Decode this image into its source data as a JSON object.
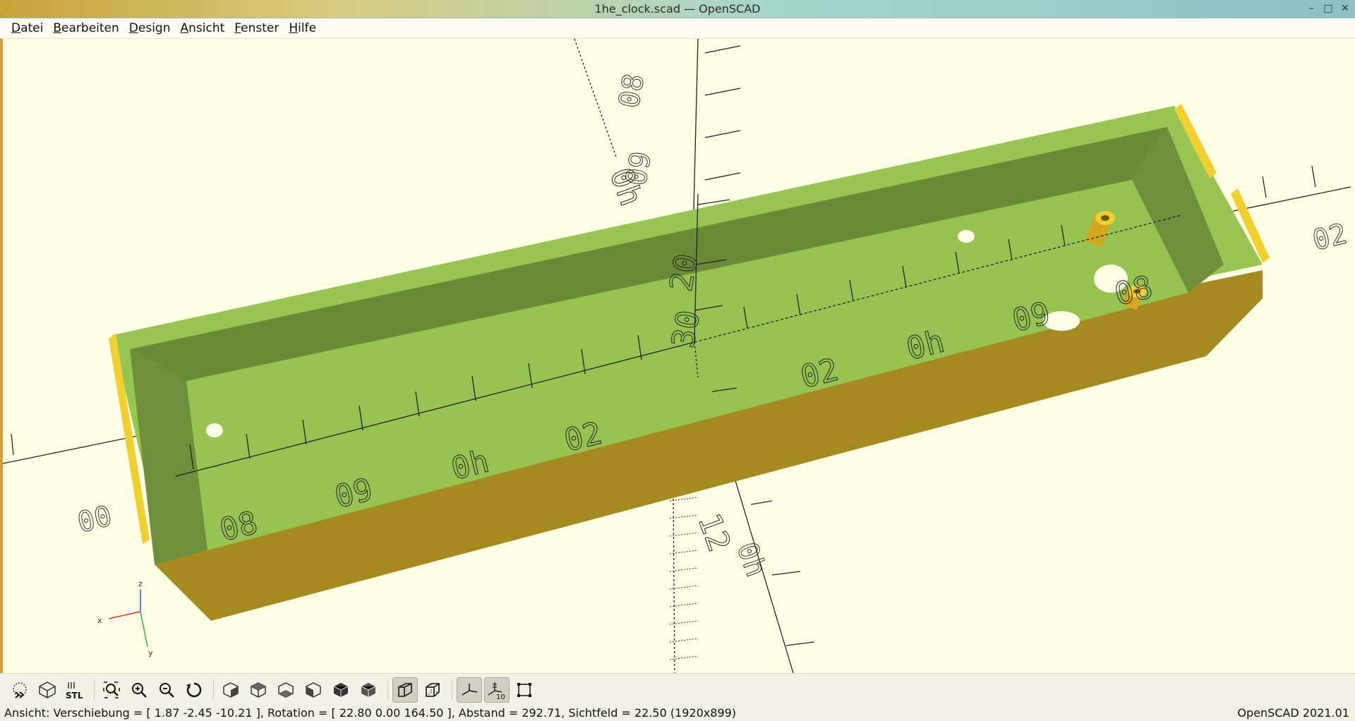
{
  "window": {
    "title": "1he_clock.scad — OpenSCAD",
    "buttons": [
      "minimize",
      "maximize",
      "close"
    ]
  },
  "menu": {
    "items": [
      {
        "label": "Datei",
        "acc": "D",
        "rest": "atei"
      },
      {
        "label": "Bearbeiten",
        "acc": "B",
        "rest": "earbeiten"
      },
      {
        "label": "Design",
        "acc": "D",
        "rest": "esign"
      },
      {
        "label": "Ansicht",
        "acc": "A",
        "rest": "nsicht"
      },
      {
        "label": "Fenster",
        "acc": "F",
        "rest": "enster"
      },
      {
        "label": "Hilfe",
        "acc": "H",
        "rest": "ilfe"
      }
    ]
  },
  "axis_labels": {
    "neg_left": [
      "00",
      "08",
      "09",
      "0h",
      "02"
    ],
    "pos_right": [
      "02",
      "0h",
      "09",
      "08",
      "02"
    ],
    "vertical_up": [
      "20",
      "30",
      "08",
      "0h",
      "09"
    ],
    "vertical_down": [
      "12",
      "0h"
    ]
  },
  "axes_gizmo": {
    "x": "x",
    "y": "y",
    "z": "z"
  },
  "colors": {
    "model_top": "#99c555",
    "model_inner_wall": "#6a8a38",
    "model_outer_side": "#a48a20",
    "model_highlight": "#f0cf30",
    "viewport_bg": "#ffffe6"
  },
  "toolbar": {
    "buttons": [
      {
        "name": "preview-button",
        "icon": "preview-icon"
      },
      {
        "name": "render-button",
        "icon": "render-icon"
      },
      {
        "name": "export-stl-button",
        "icon": "stl-icon",
        "label": "STL"
      },
      {
        "name": "view-all-button",
        "icon": "view-all-icon"
      },
      {
        "name": "zoom-in-button",
        "icon": "zoom-in-icon"
      },
      {
        "name": "zoom-out-button",
        "icon": "zoom-out-icon"
      },
      {
        "name": "reset-view-button",
        "icon": "reset-view-icon"
      },
      {
        "name": "view-right-button",
        "icon": "view-right-icon"
      },
      {
        "name": "view-top-button",
        "icon": "view-top-icon"
      },
      {
        "name": "view-bottom-button",
        "icon": "view-bottom-icon"
      },
      {
        "name": "view-left-button",
        "icon": "view-left-icon"
      },
      {
        "name": "view-front-button",
        "icon": "view-front-icon"
      },
      {
        "name": "view-back-button",
        "icon": "view-back-icon"
      },
      {
        "name": "perspective-button",
        "icon": "perspective-icon",
        "active": true
      },
      {
        "name": "orthogonal-button",
        "icon": "orthogonal-icon"
      },
      {
        "name": "show-axes-button",
        "icon": "axes-icon",
        "active": true
      },
      {
        "name": "show-scale-markers-button",
        "icon": "scale-markers-icon",
        "label": "10",
        "active": true
      },
      {
        "name": "show-edges-button",
        "icon": "edges-icon"
      }
    ]
  },
  "status": {
    "view": "Ansicht: Verschiebung = [ 1.87 -2.45 -10.21 ], Rotation = [ 22.80 0.00 164.50 ], Abstand = 292.71, Sichtfeld = 22.50 (1920x899)",
    "version": "OpenSCAD 2021.01"
  }
}
